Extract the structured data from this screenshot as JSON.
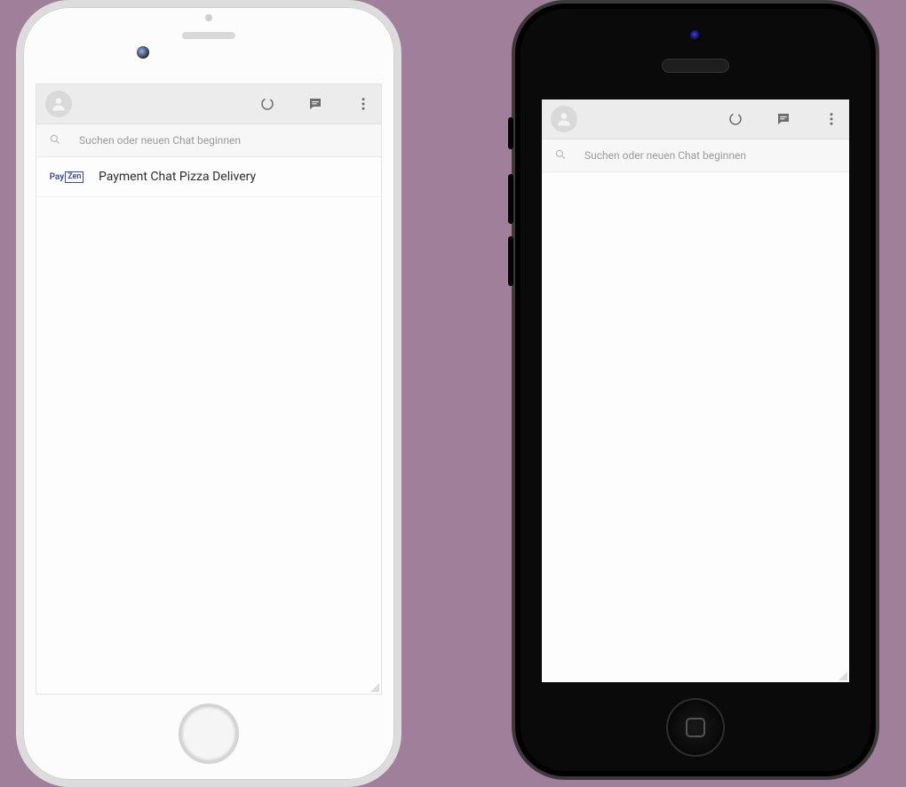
{
  "left": {
    "search_placeholder": "Suchen oder neuen Chat beginnen",
    "chat_items": [
      {
        "avatar_label_a": "Pay",
        "avatar_label_b": "Zen",
        "title": "Payment Chat Pizza Delivery"
      }
    ]
  },
  "right": {
    "search_placeholder": "Suchen oder neuen Chat beginnen",
    "chat_items": []
  },
  "icons": {
    "status": "status-ring-icon",
    "new_chat": "new-chat-icon",
    "menu": "menu-dots-icon",
    "search": "search-icon",
    "profile": "profile-avatar-icon"
  }
}
